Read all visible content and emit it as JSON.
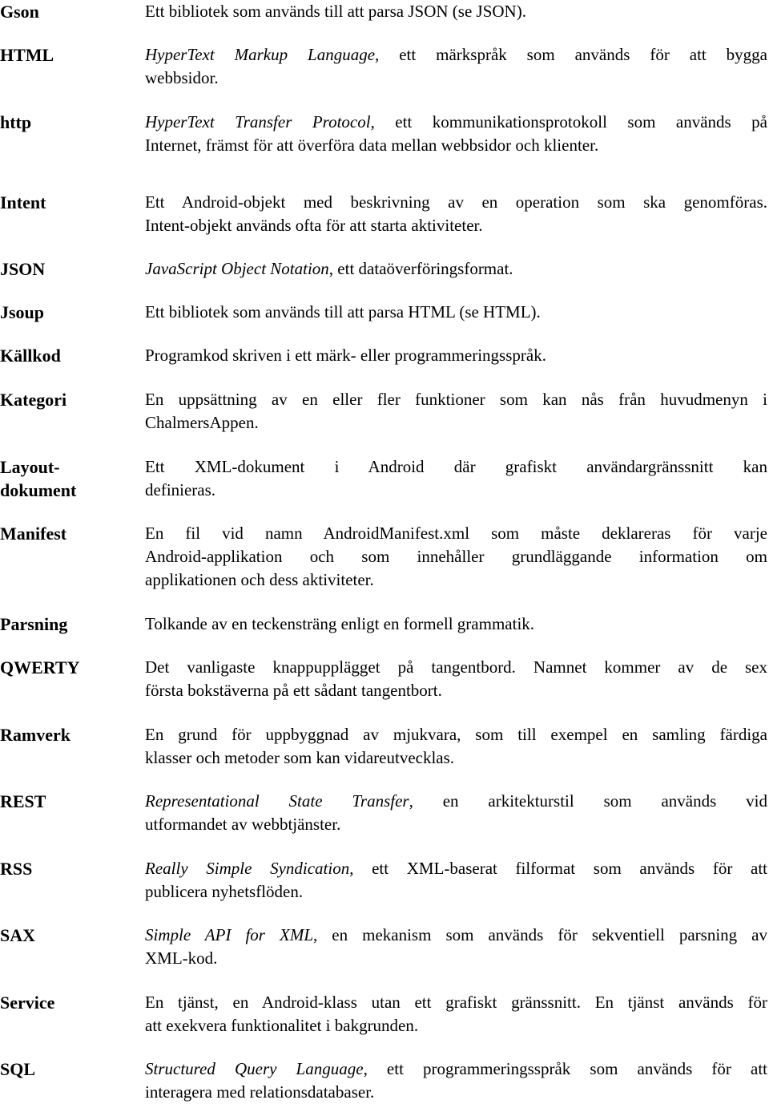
{
  "glossary": [
    {
      "term": [
        "Gson"
      ],
      "italic": "",
      "lines": [
        "Ett bibliotek som används till att parsa JSON (se JSON)."
      ]
    },
    {
      "term": [
        "HTML"
      ],
      "italic": "HyperText Markup Language",
      "lines": [
        ", ett märkspråk som används för att bygga",
        "webbsidor."
      ]
    },
    {
      "term": [
        "http"
      ],
      "italic": "HyperText Transfer Protocol",
      "lines": [
        ", ett kommunikationsprotokoll som används på",
        "Internet, främst för att överföra data mellan webbsidor och klienter."
      ]
    },
    {
      "term": [
        "Intent"
      ],
      "italic": "",
      "lines": [
        "Ett Android-objekt med beskrivning av en operation som ska genomföras.",
        "Intent-objekt används ofta för att starta aktiviteter."
      ]
    },
    {
      "term": [
        "JSON"
      ],
      "italic": "JavaScript Object Notation",
      "lines": [
        ", ett dataöverföringsformat."
      ]
    },
    {
      "term": [
        "Jsoup"
      ],
      "italic": "",
      "lines": [
        "Ett bibliotek som används till att parsa HTML (se HTML)."
      ]
    },
    {
      "term": [
        "Källkod"
      ],
      "italic": "",
      "lines": [
        "Programkod skriven i ett märk- eller programmeringsspråk."
      ]
    },
    {
      "term": [
        "Kategori"
      ],
      "italic": "",
      "lines": [
        "En uppsättning av en eller fler funktioner som kan nås från huvudmenyn i",
        "ChalmersAppen."
      ]
    },
    {
      "term": [
        "Layout-",
        "dokument"
      ],
      "italic": "",
      "lines": [
        "Ett XML-dokument i Android där grafiskt användargränssnitt kan",
        "definieras."
      ]
    },
    {
      "term": [
        "Manifest"
      ],
      "italic": "",
      "lines": [
        "En fil vid namn AndroidManifest.xml som måste deklareras för varje",
        "Android-applikation och som innehåller grundläggande information om",
        "applikationen och dess aktiviteter."
      ]
    },
    {
      "term": [
        "Parsning"
      ],
      "italic": "",
      "lines": [
        "Tolkande av en teckensträng enligt en formell grammatik."
      ]
    },
    {
      "term": [
        "QWERTY"
      ],
      "italic": "",
      "lines": [
        "Det vanligaste knappupplägget på tangentbord. Namnet kommer av de sex",
        "första bokstäverna på ett sådant tangentbort."
      ]
    },
    {
      "term": [
        "Ramverk"
      ],
      "italic": "",
      "lines": [
        "En grund för uppbyggnad av mjukvara, som till exempel en samling färdiga",
        "klasser och metoder som kan vidareutvecklas."
      ]
    },
    {
      "term": [
        "REST"
      ],
      "italic": "Representational State Transfer",
      "lines": [
        ", en arkitekturstil som används vid",
        "utformandet av webbtjänster."
      ]
    },
    {
      "term": [
        "RSS"
      ],
      "italic": "Really Simple Syndication",
      "lines": [
        ", ett XML-baserat filformat som används för att",
        "publicera nyhetsflöden."
      ]
    },
    {
      "term": [
        "SAX"
      ],
      "italic": "Simple API for XML",
      "lines": [
        ", en mekanism som används för sekventiell parsning av",
        "XML-kod."
      ]
    },
    {
      "term": [
        "Service"
      ],
      "italic": "",
      "lines": [
        "En tjänst, en Android-klass utan ett grafiskt gränssnitt. En tjänst används för",
        "att exekvera funktionalitet i bakgrunden."
      ]
    },
    {
      "term": [
        "SQL"
      ],
      "italic": "Structured Query Language",
      "lines": [
        ", ett programmeringsspråk som används för att",
        "interagera med relationsdatabaser."
      ]
    }
  ]
}
